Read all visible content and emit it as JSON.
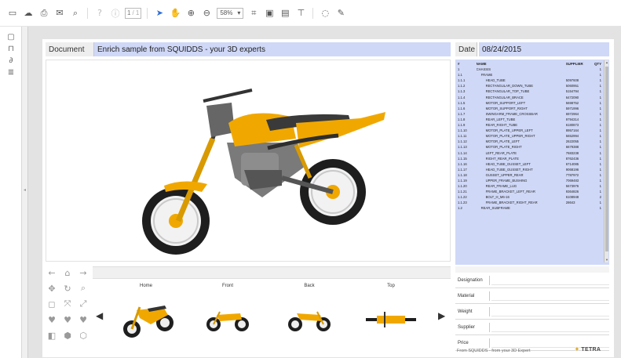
{
  "toolbar": {
    "page_current": "1",
    "page_total": "/ 1",
    "zoom": "58%",
    "icons": [
      "save-icon",
      "cloud-icon",
      "print-icon",
      "email-icon",
      "search-icon",
      "help-icon",
      "info-icon",
      "pointer-icon",
      "pan-hand-icon",
      "zoom-in-icon",
      "zoom-out-icon",
      "crop-icon",
      "export-icon",
      "image-icon",
      "stamp-icon",
      "comment-icon",
      "pen-icon"
    ]
  },
  "leftbar": {
    "icons": [
      "pages-icon",
      "bookmark-icon",
      "attachment-icon",
      "layers-icon"
    ]
  },
  "header": {
    "document_label": "Document",
    "document_title": "Enrich sample from SQUIDDS - your 3D experts",
    "date_label": "Date",
    "date_value": "08/24/2015"
  },
  "bom": {
    "columns": [
      "#",
      "NAME",
      "SUPPLIER",
      "QTY"
    ],
    "rows": [
      [
        "1",
        "CHASSIS",
        "",
        "1"
      ],
      [
        "1.1",
        "FRAME",
        "",
        "1"
      ],
      [
        "1.1.1",
        "HEAD_TUBE",
        "5097608",
        "1"
      ],
      [
        "1.1.2",
        "RECTANGULAR_DOWN_TUBE",
        "5060951",
        "1"
      ],
      [
        "1.1.3",
        "RECTANGULAR_TOP_TUBE",
        "5154794",
        "1"
      ],
      [
        "1.1.4",
        "RECTANGULAR_BRACE",
        "6472090",
        "1"
      ],
      [
        "1.1.5",
        "MOTOR_SUPPORT_LEFT",
        "5698752",
        "1"
      ],
      [
        "1.1.6",
        "MOTOR_SUPPORT_RIGHT",
        "5971996",
        "1"
      ],
      [
        "1.1.7",
        "SWINGARM_FRAME_CROSSBAR",
        "6972964",
        "1"
      ],
      [
        "1.1.8",
        "REAR_LEFT_TUBE",
        "9794314",
        "1"
      ],
      [
        "1.1.9",
        "REAR_RIGHT_TUBE",
        "6180873",
        "1"
      ],
      [
        "1.1.10",
        "MOTOR_PLATE_UPPER_LEFT",
        "8957164",
        "1"
      ],
      [
        "1.1.11",
        "MOTOR_PLATE_UPPER_RIGHT",
        "5652994",
        "1"
      ],
      [
        "1.1.12",
        "MOTOR_PLATE_LEFT",
        "2622055",
        "1"
      ],
      [
        "1.1.13",
        "MOTOR_PLATE_RIGHT",
        "6679388",
        "1"
      ],
      [
        "1.1.14",
        "LEFT_REAR_PLATE",
        "7683238",
        "1"
      ],
      [
        "1.1.15",
        "RIGHT_REAR_PLATE",
        "8762436",
        "1"
      ],
      [
        "1.1.16",
        "HEAD_TUBE_GUSSET_LEFT",
        "6714085",
        "1"
      ],
      [
        "1.1.17",
        "HEAD_TUBE_GUSSET_RIGHT",
        "9068196",
        "1"
      ],
      [
        "1.1.18",
        "GUSSET_UPPER_REAR",
        "7787972",
        "1"
      ],
      [
        "1.1.19",
        "UPPER_FRAME_BUSHING",
        "7069483",
        "1"
      ],
      [
        "1.1.20",
        "REAR_FRAME_LUG",
        "5673976",
        "1"
      ],
      [
        "1.1.21",
        "FRAME_BRACKET_LEFT_REAR",
        "9364826",
        "1"
      ],
      [
        "1.1.22",
        "BOLT_H_M6-16",
        "6108948",
        "2"
      ],
      [
        "1.1.23",
        "FRAME_BRACKET_RIGHT_REAR",
        "28643",
        "1"
      ],
      [
        "1.2",
        "REAR_SUBFRAME",
        "",
        "1"
      ]
    ]
  },
  "navtools": {
    "icons": [
      "arrow-left-icon",
      "home-icon",
      "arrow-right-icon",
      "pan-icon",
      "rotate-icon",
      "zoom-area-icon",
      "fit-view-icon",
      "fit-all-icon",
      "explode-icon",
      "view-iso-1-icon",
      "view-iso-2-icon",
      "view-iso-3-icon",
      "shading-icon",
      "cube-icon",
      "wireframe-icon"
    ]
  },
  "thumbnails": [
    {
      "label": "Home"
    },
    {
      "label": "Front"
    },
    {
      "label": "Back"
    },
    {
      "label": "Top"
    }
  ],
  "properties": [
    {
      "label": "Designation"
    },
    {
      "label": "Material"
    },
    {
      "label": "Weight"
    },
    {
      "label": "Supplier"
    },
    {
      "label": "Price"
    }
  ],
  "footer": {
    "text": "From SQUIDDS - from your 3D Expert",
    "logo": "TETRA"
  },
  "colors": {
    "accent": "#cfd8f7",
    "bike_orange": "#f0a800",
    "toolbar_accent": "#2f6fd6"
  }
}
